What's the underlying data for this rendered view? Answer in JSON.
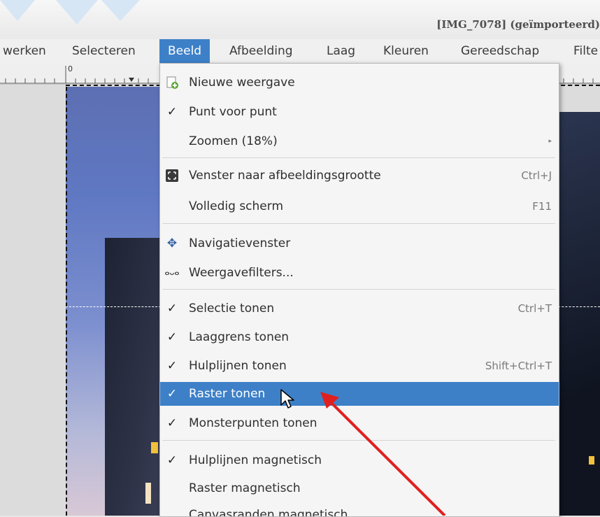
{
  "window": {
    "title": "[IMG_7078] (geïmporteerd)"
  },
  "menubar": {
    "items": [
      {
        "label": "werken"
      },
      {
        "label": "Selecteren"
      },
      {
        "label": "Beeld",
        "active": true
      },
      {
        "label": "Afbeelding"
      },
      {
        "label": "Laag"
      },
      {
        "label": "Kleuren"
      },
      {
        "label": "Gereedschap"
      },
      {
        "label": "Filte"
      }
    ]
  },
  "ruler": {
    "origin_label": "0"
  },
  "menu": {
    "items": [
      {
        "label": "Nieuwe weergave",
        "icon": "new-view-icon",
        "shortcut": ""
      },
      {
        "label": "Punt voor punt",
        "icon": "check-icon",
        "shortcut": ""
      },
      {
        "label": "Zoomen (18%)",
        "icon": "",
        "shortcut": "",
        "submenu": true
      },
      {
        "label": "Venster naar afbeeldingsgrootte",
        "icon": "shrink-wrap-icon",
        "shortcut": "Ctrl+J"
      },
      {
        "label": "Volledig scherm",
        "icon": "",
        "shortcut": "F11"
      },
      {
        "label": "Navigatievenster",
        "icon": "navigate-icon",
        "shortcut": ""
      },
      {
        "label": "Weergavefilters...",
        "icon": "glasses-icon",
        "shortcut": ""
      },
      {
        "label": "Selectie tonen",
        "icon": "check-icon",
        "shortcut": "Ctrl+T"
      },
      {
        "label": "Laaggrens tonen",
        "icon": "check-icon",
        "shortcut": ""
      },
      {
        "label": "Hulplijnen tonen",
        "icon": "check-icon",
        "shortcut": "Shift+Ctrl+T"
      },
      {
        "label": "Raster tonen",
        "icon": "check-icon",
        "shortcut": "",
        "highlighted": true
      },
      {
        "label": "Monsterpunten tonen",
        "icon": "check-icon",
        "shortcut": ""
      },
      {
        "label": "Hulplijnen magnetisch",
        "icon": "check-icon",
        "shortcut": ""
      },
      {
        "label": "Raster magnetisch",
        "icon": "",
        "shortcut": ""
      },
      {
        "label": "Canvasranden magnetisch",
        "icon": "",
        "shortcut": ""
      }
    ]
  },
  "colors": {
    "highlight": "#3d80c8",
    "arrow": "#e02020"
  }
}
